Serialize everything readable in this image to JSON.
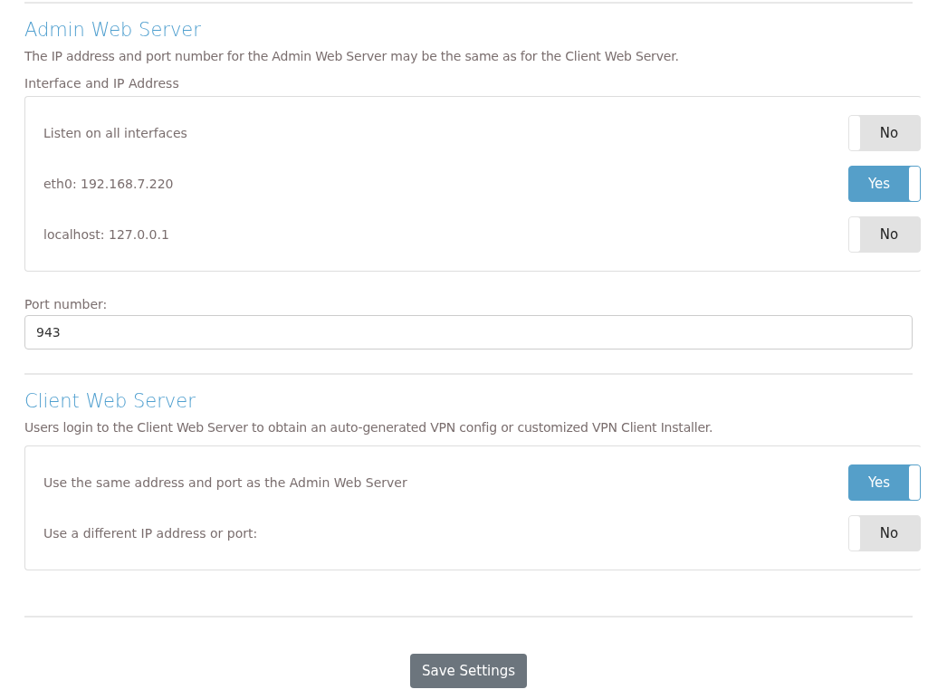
{
  "admin": {
    "title": "Admin Web Server",
    "description": "The IP address and port number for the Admin Web Server may be the same as for the Client Web Server.",
    "group_label": "Interface and IP Address",
    "options": [
      {
        "label": "Listen on all interfaces",
        "on": false,
        "toggle_text": "No"
      },
      {
        "label": "eth0: 192.168.7.220",
        "on": true,
        "toggle_text": "Yes"
      },
      {
        "label": "localhost: 127.0.0.1",
        "on": false,
        "toggle_text": "No"
      }
    ],
    "port_label": "Port number:",
    "port_value": "943"
  },
  "client": {
    "title": "Client Web Server",
    "description": "Users login to the Client Web Server to obtain an auto-generated VPN config or customized VPN Client Installer.",
    "options": [
      {
        "label": "Use the same address and port as the Admin Web Server",
        "on": true,
        "toggle_text": "Yes"
      },
      {
        "label": "Use a different IP address or port:",
        "on": false,
        "toggle_text": "No"
      }
    ]
  },
  "save_button": "Save Settings"
}
